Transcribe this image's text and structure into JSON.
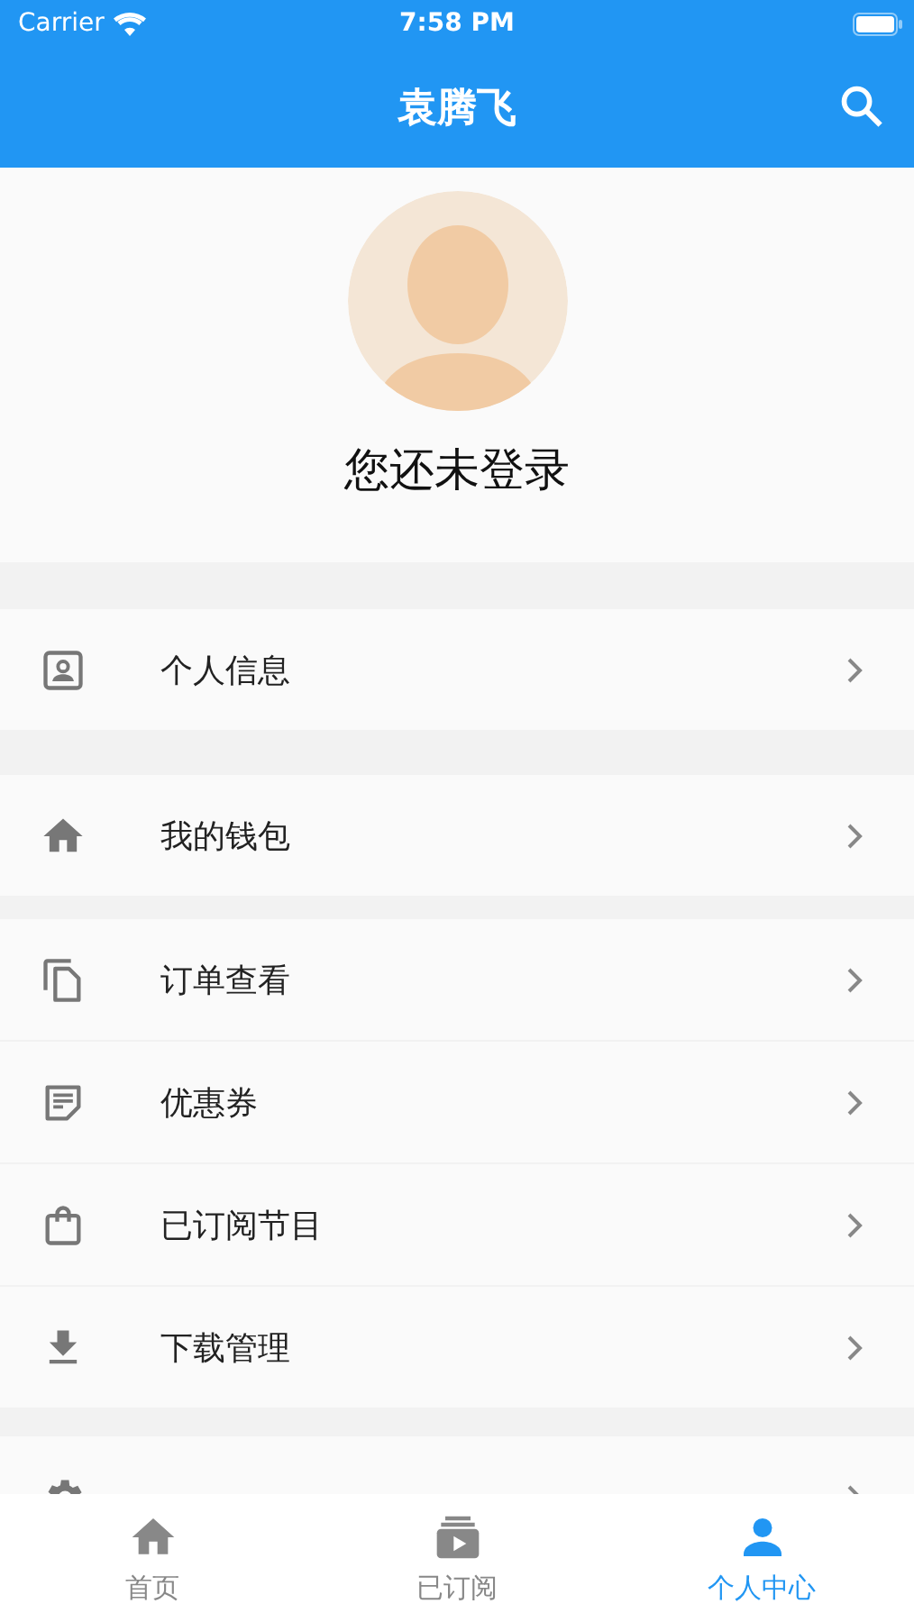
{
  "status_bar": {
    "carrier": "Carrier",
    "time": "7:58 PM"
  },
  "header": {
    "title": "袁腾飞"
  },
  "profile": {
    "login_prompt": "您还未登录"
  },
  "sections": [
    {
      "items": [
        {
          "kind": "contact",
          "label": "个人信息"
        }
      ]
    },
    {
      "items": [
        {
          "kind": "home",
          "label": "我的钱包"
        }
      ]
    },
    {
      "items": [
        {
          "kind": "copy",
          "label": "订单查看"
        },
        {
          "kind": "note",
          "label": "优惠券"
        },
        {
          "kind": "bag",
          "label": "已订阅节目"
        },
        {
          "kind": "download",
          "label": "下载管理"
        }
      ]
    },
    {
      "items": [
        {
          "kind": "gear"
        }
      ]
    }
  ],
  "tab_bar": [
    {
      "kind": "home",
      "label": "首页",
      "selected": false
    },
    {
      "kind": "subs",
      "label": "已订阅",
      "selected": false
    },
    {
      "kind": "person",
      "label": "个人中心",
      "selected": true
    }
  ]
}
